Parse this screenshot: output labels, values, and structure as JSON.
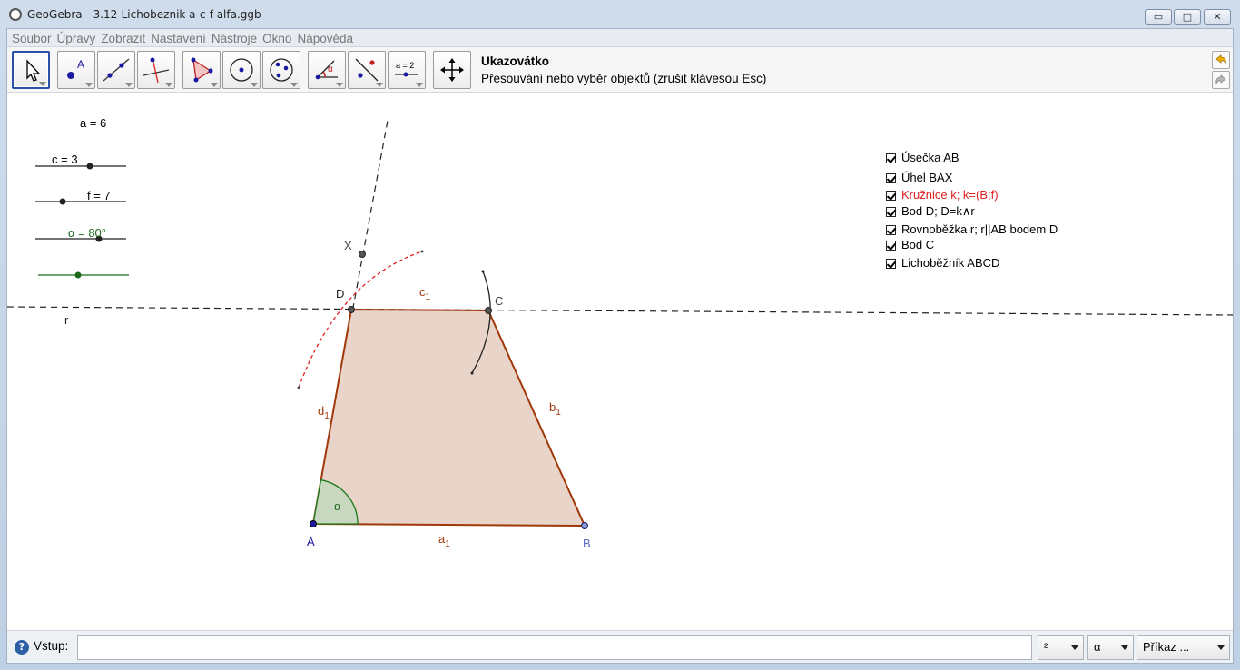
{
  "window": {
    "title": "GeoGebra - 3.12-Lichobeznik a-c-f-alfa.ggb",
    "min_glyph": "▭",
    "max_glyph": "□",
    "close_glyph": "✕"
  },
  "menu": [
    "Soubor",
    "Úpravy",
    "Zobrazit",
    "Nastavení",
    "Nástroje",
    "Okno",
    "Nápověda"
  ],
  "toolbar": {
    "tools": [
      "move-tool",
      "point-tool",
      "line-tool",
      "perpendicular-tool",
      "polygon-tool",
      "circle-tool",
      "conic-tool",
      "angle-tool",
      "reflect-tool",
      "slider-tool",
      "move-view-tool"
    ],
    "active_tool_name": "Ukazovátko",
    "active_tool_help": "Přesouvání nebo výběr objektů (zrušit klávesou Esc)",
    "slider_icon_text": "a = 2"
  },
  "sliders": [
    {
      "label": "a = 6",
      "color": "#000000"
    },
    {
      "label": "c = 3",
      "color": "#000000"
    },
    {
      "label": "f = 7",
      "color": "#000000"
    },
    {
      "label": "α = 80°",
      "color": "#006400"
    }
  ],
  "checkboxes": [
    {
      "label": "Úsečka AB",
      "color": "#000000",
      "checked": true
    },
    {
      "label": "Úhel BAX",
      "color": "#000000",
      "checked": true
    },
    {
      "label": "Kružnice k; k=(B;f)",
      "color": "#e02020",
      "checked": true
    },
    {
      "label": "Bod D; D=k∧r",
      "color": "#000000",
      "checked": true
    },
    {
      "label": "Rovnoběžka r; r||AB bodem D",
      "color": "#000000",
      "checked": true
    },
    {
      "label": "Bod C",
      "color": "#000000",
      "checked": true
    },
    {
      "label": "Lichoběžník ABCD",
      "color": "#000000",
      "checked": true
    }
  ],
  "geometry": {
    "points": {
      "A": "A",
      "B": "B",
      "C": "C",
      "D": "D",
      "X": "X"
    },
    "segments": {
      "a1": "a",
      "b1": "b",
      "c1": "c",
      "d1": "d",
      "sub": "1"
    },
    "line_r": "r",
    "angle": "α",
    "colors": {
      "polygon_fill": "#e8d4c8",
      "polygon_edge": "#a0380a",
      "angle_fill": "#c8d8c0",
      "angle_edge": "#1a7a1a",
      "point_blue": "#1a1aa0",
      "circle_red": "#e02020"
    }
  },
  "input": {
    "label": "Vstup:",
    "value": "",
    "help_glyph": "?",
    "combo_power": "²",
    "combo_symbol": "α",
    "combo_command": "Příkaz ..."
  }
}
